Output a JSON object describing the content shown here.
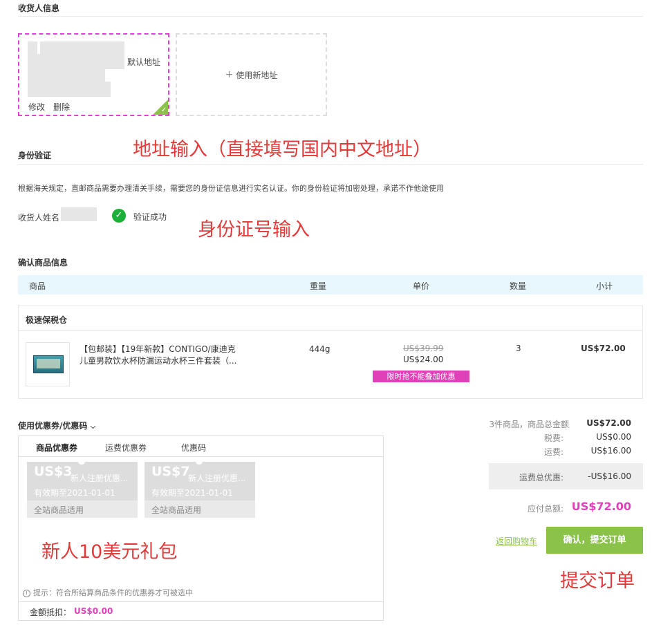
{
  "consignee": {
    "title": "收货人信息",
    "default_tag": "默认地址",
    "edit_label": "修改",
    "delete_label": "删除",
    "new_address_label": "使用新地址"
  },
  "identity": {
    "title": "身份验证",
    "notice": "根据海关规定，直邮商品需要办理清关手续，需要您的身份证信息进行实名认证。你的身份验证将加密处理，承诺不作他途使用",
    "name_label": "收货人姓名",
    "verified_label": "验证成功"
  },
  "annotations": {
    "address": "地址输入（直接填写国内中文地址）",
    "id": "身份证号输入",
    "newbie": "新人10美元礼包",
    "submit": "提交订单"
  },
  "products": {
    "title": "确认商品信息",
    "columns": [
      "商品",
      "重量",
      "单价",
      "数量",
      "小计"
    ],
    "warehouse": "极速保税仓",
    "item": {
      "name_line1": "【包邮装】【19年新款】CONTIGO/康迪克",
      "name_line2": "儿童男款饮水杯防漏运动水杯三件套装（...",
      "weight": "444g",
      "original_price": "US$39.99",
      "price": "US$24.00",
      "promo_badge": "限时抢不能叠加优惠",
      "quantity": "3",
      "subtotal": "US$72.00"
    }
  },
  "coupons": {
    "title": "使用优惠券/优惠码",
    "tabs": [
      "商品优惠券",
      "运费优惠券",
      "优惠码"
    ],
    "items": [
      {
        "amount": "US$3",
        "name": "新人注册优惠...",
        "expiry": "有效期至2021-01-01",
        "scope": "全站商品适用"
      },
      {
        "amount": "US$7",
        "name": "新人注册优惠...",
        "expiry": "有效期至2021-01-01",
        "scope": "全站商品适用"
      }
    ],
    "hint": "提示：符合所结算商品条件的优惠券才可被选中",
    "deduct_label": "金额抵扣：",
    "deduct_value": "US$0.00"
  },
  "summary": {
    "goods_label": "3件商品，商品总金额",
    "goods_value": "US$72.00",
    "tax_label": "税费:",
    "tax_value": "US$0.00",
    "shipping_label": "运费:",
    "shipping_value": "US$16.00",
    "shipping_discount_label": "运费总优惠:",
    "shipping_discount_value": "-US$16.00",
    "total_label": "应付总额:",
    "total_value": "US$72.00",
    "back_link": "返回购物车",
    "submit_label": "确认，提交订单"
  },
  "colors": {
    "accent_green": "#8bc34a",
    "accent_pink": "#e040b8",
    "annotation_red": "#e23a3a",
    "header_blue": "#e8f6fd"
  }
}
